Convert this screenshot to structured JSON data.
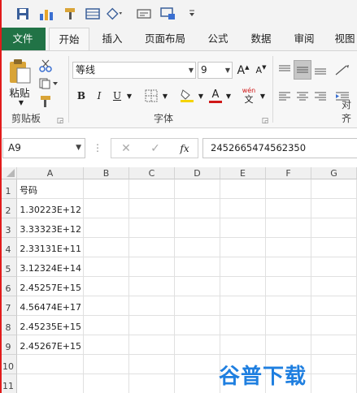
{
  "quick_access": {
    "icons": [
      "save-icon",
      "chart-icon",
      "format-painter-icon",
      "table-icon",
      "shape-icon",
      "label-icon",
      "screen-icon",
      "customize-icon"
    ]
  },
  "tabs": [
    {
      "label": "文件"
    },
    {
      "label": "开始"
    },
    {
      "label": "插入"
    },
    {
      "label": "页面布局"
    },
    {
      "label": "公式"
    },
    {
      "label": "数据"
    },
    {
      "label": "审阅"
    },
    {
      "label": "视图"
    }
  ],
  "ribbon": {
    "clipboard": {
      "paste_label": "粘贴",
      "group_label": "剪贴板"
    },
    "font": {
      "font_name": "等线",
      "font_size": "9",
      "group_label": "字体",
      "bold": "B",
      "italic": "I",
      "underline": "U",
      "grow": "A",
      "shrink": "A",
      "font_color": "A",
      "phonetic": "wén",
      "phonetic_char": "文"
    },
    "alignment": {
      "group_label": "对齐"
    }
  },
  "formula_bar": {
    "name_box": "A9",
    "fx_label": "fx",
    "content": "2452665474562350"
  },
  "grid": {
    "columns": [
      "A",
      "B",
      "C",
      "D",
      "E",
      "F",
      "G"
    ],
    "rows": [
      {
        "n": "1",
        "a": "号码"
      },
      {
        "n": "2",
        "a": "1.30223E+12"
      },
      {
        "n": "3",
        "a": "3.33323E+12"
      },
      {
        "n": "4",
        "a": "2.33131E+11"
      },
      {
        "n": "5",
        "a": "3.12324E+14"
      },
      {
        "n": "6",
        "a": "2.45257E+15"
      },
      {
        "n": "7",
        "a": "4.56474E+17"
      },
      {
        "n": "8",
        "a": "2.45235E+15"
      },
      {
        "n": "9",
        "a": "2.45267E+15"
      },
      {
        "n": "10",
        "a": ""
      },
      {
        "n": "11",
        "a": ""
      }
    ]
  },
  "watermark": {
    "text": "谷普下载",
    "color": "#1f7fe0"
  },
  "colors": {
    "brand": "#217346",
    "accent_red": "#e21b1b",
    "selection": "#217346"
  }
}
